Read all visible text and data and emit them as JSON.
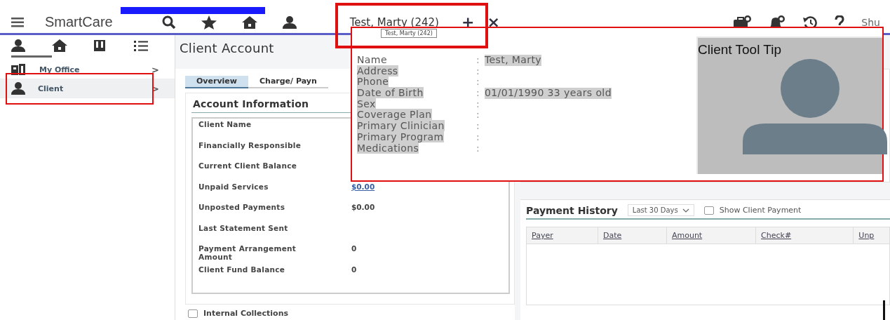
{
  "top_bar": {
    "logo": "SmartCare",
    "open_tab": {
      "label": "Test, Marty (242)",
      "add": "+",
      "close": "×"
    },
    "user_label": "Shu"
  },
  "sidebar": {
    "tabs": [
      {
        "kind": "person",
        "selected": true
      },
      {
        "kind": "home",
        "selected": false
      },
      {
        "kind": "book",
        "selected": false
      },
      {
        "kind": "list",
        "selected": false
      }
    ],
    "items": [
      {
        "kind": "office",
        "label": "My Office",
        "arrow": ">",
        "selected": false
      },
      {
        "kind": "person",
        "label": "Client",
        "arrow": ">",
        "selected": true
      }
    ]
  },
  "page": {
    "title": "Client Account",
    "tabs": [
      {
        "label": "Overview",
        "selected": true
      },
      {
        "label": "Charge/ Payn",
        "selected": false
      }
    ],
    "account_information": {
      "title": "Account Information",
      "fields": [
        {
          "label": "Client Name"
        },
        {
          "label": "Financially Responsible"
        },
        {
          "label": "Current Client Balance"
        },
        {
          "label": "Unpaid Services",
          "value": "$0.00",
          "kind": "link"
        },
        {
          "label": "Unposted Payments",
          "value": "$0.00",
          "kind": "text"
        },
        {
          "label": "Last Statement Sent"
        },
        {
          "label": "Payment Arrangement Amount",
          "value": "0",
          "kind": "text"
        },
        {
          "label": "Client Fund Balance",
          "value": "0",
          "kind": "text"
        }
      ],
      "internal_collections": {
        "label": "Internal Collections",
        "checked": false
      }
    },
    "payment_history": {
      "title": "Payment History",
      "filter": "Last 30 Days",
      "show_client_payments": {
        "label": "Show Client Payment",
        "checked": false
      },
      "columns": [
        "Payer",
        "Date",
        "Amount",
        "Check#",
        "Unp"
      ]
    }
  },
  "tooltip": {
    "tab_label": "Test, Marty (242)",
    "image_caption": "Client Tool Tip",
    "fields": [
      {
        "label": "Name",
        "separator": ":",
        "value": "Test, Marty"
      },
      {
        "label": "Address",
        "separator": ":"
      },
      {
        "label": "Phone",
        "separator": ":"
      },
      {
        "label": "Date of Birth",
        "separator": ":",
        "value": "01/01/1990 33 years old"
      },
      {
        "label": "Sex",
        "separator": ":"
      },
      {
        "label": "Coverage Plan",
        "separator": ":"
      },
      {
        "label": "Primary Clinician",
        "separator": ":"
      },
      {
        "label": "Primary Program",
        "separator": ":"
      },
      {
        "label": "Medications",
        "separator": ":"
      }
    ]
  }
}
